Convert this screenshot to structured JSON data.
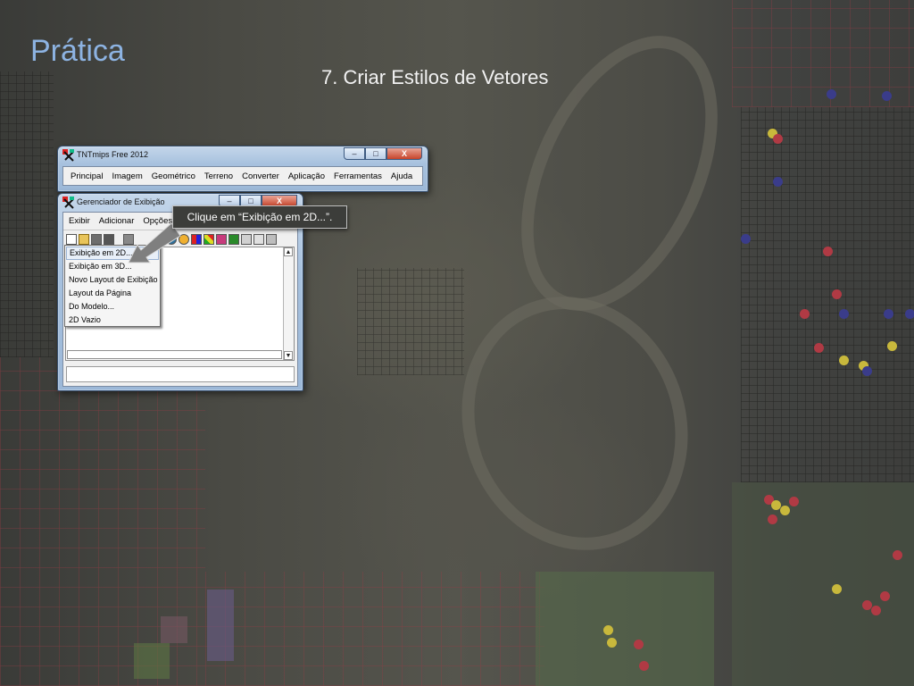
{
  "slide": {
    "title": "Prática",
    "subtitle": "7. Criar Estilos de Vetores"
  },
  "main_window": {
    "title": "TNTmips Free 2012",
    "menu": [
      "Principal",
      "Imagem",
      "Geométrico",
      "Terreno",
      "Converter",
      "Aplicação",
      "Ferramentas",
      "Ajuda"
    ]
  },
  "display_manager": {
    "title": "Gerenciador de Exibição",
    "menu": [
      "Exibir",
      "Adicionar",
      "Opções"
    ],
    "dropdown_items": [
      "Exibição em 2D...",
      "Exibição em 3D...",
      "Novo Layout de Exibição",
      "Layout da Página",
      "Do Modelo...",
      "2D Vazio"
    ],
    "selected_item": "Exibição em 2D..."
  },
  "callout": {
    "text": "Clique em “Exibição em 2D...”."
  },
  "window_buttons": {
    "minimize": "–",
    "maximize": "□",
    "close": "X"
  },
  "colors": {
    "title_color": "#8db3e2",
    "callout_bg": "#3c3d3a",
    "arrow_fill": "#7f7f7f"
  },
  "icons": [
    "app-icon",
    "new-file-icon",
    "open-folder-icon",
    "save-icon",
    "layers-icon",
    "display-toolbar-icons"
  ]
}
